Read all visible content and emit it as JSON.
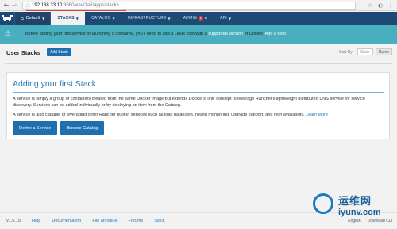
{
  "browser": {
    "url_host": "192.168.33.10",
    "url_path": ":8080/env/1a5/apps/stacks"
  },
  "nav": {
    "environment": "Default",
    "items": [
      {
        "label": "STACKS",
        "active": true
      },
      {
        "label": "CATALOG",
        "active": false
      },
      {
        "label": "INFRASTRUCTURE",
        "active": false
      },
      {
        "label": "ADMIN",
        "active": false,
        "badge": "!"
      },
      {
        "label": "API",
        "active": false
      }
    ]
  },
  "banner": {
    "text_before": "Before adding your first service or launching a container, you'll need to add a Linux host with a ",
    "link1": "supported version",
    "text_middle": " of Docker. ",
    "link2": "Add a host"
  },
  "header": {
    "title": "User Stacks",
    "add_button": "Add Stack",
    "sort_label": "Sort By:",
    "sort_options": [
      "State",
      "Name"
    ],
    "sort_selected": "Name"
  },
  "card": {
    "title": "Adding your first Stack",
    "para1": "A service is simply a group of containers created from the same Docker image but extends Docker's 'link' concept to leverage Rancher's lightweight distributed DNS service for service discovery. Services can be added individually or by deploying an item from the Catalog.",
    "para2": "A service is also capable of leveraging other Rancher built-in services such as load balancers, health monitoring, upgrade support, and high availability.",
    "learn_more": "Learn More",
    "btn_define": "Define a Service",
    "btn_browse": "Browse Catalog"
  },
  "footer": {
    "version": "v1.6.15",
    "links": [
      "Help",
      "Documentation",
      "File an Issue",
      "Forums",
      "Slack"
    ],
    "right": [
      "English",
      "Download CLI"
    ]
  },
  "watermark": {
    "cn": "运维网",
    "en": "iyunv.com"
  },
  "colors": {
    "nav_bg": "#1d4a75",
    "banner_bg": "#49aebd",
    "accent": "#2778b6",
    "button": "#1d6faf"
  }
}
